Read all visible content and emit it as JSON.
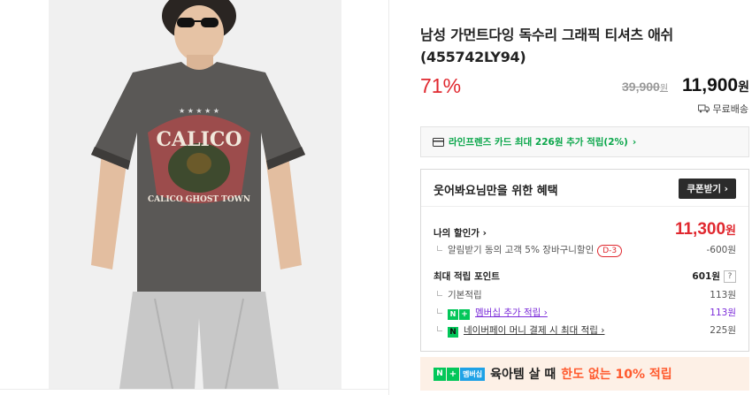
{
  "product": {
    "title": "남성 가먼트다잉 독수리 그래픽 티셔츠 애쉬 (455742LY94)",
    "discount_rate": "71%",
    "original_price": "39,900",
    "original_price_unit": "원",
    "sale_price": "11,900",
    "sale_price_unit": "원",
    "shipping_label": "무료배송",
    "shirt_print_top": "CALICO",
    "shirt_print_bottom": "CALICO GHOST TOWN"
  },
  "card_banner": {
    "text": "라인프렌즈 카드 최대 226원 추가 적립(2%)",
    "chevron": "›"
  },
  "benefits": {
    "title": "웃어봐요님만을 위한 혜택",
    "coupon_button": "쿠폰받기 ›",
    "my_discount_label": "나의 할인가 ›",
    "my_discount_price": "11,300",
    "my_discount_unit": "원",
    "cart_discount_label": "알림받기 동의 고객 5% 장바구니할인",
    "cart_discount_dday": "D-3",
    "cart_discount_value": "-600원",
    "max_points_label": "최대 적립 포인트",
    "max_points_value": "601원",
    "help_label": "?",
    "base_points_label": "기본적립",
    "base_points_value": "113원",
    "membership_label": "멤버십 추가 적립 ›",
    "membership_value": "113원",
    "npay_label": "네이버페이 머니 결제 시 최대 적립 ›",
    "npay_value": "225원"
  },
  "promo": {
    "badge_n": "N",
    "badge_plus": "+",
    "badge_member": "멤버십",
    "text_normal": "육아템 살 때",
    "text_highlight": "한도 없는 10% 적립"
  },
  "colors": {
    "accent_red": "#e0282f",
    "naver_green": "#03c75a",
    "membership_purple": "#7b2bd9",
    "promo_orange": "#ff5a2e"
  }
}
